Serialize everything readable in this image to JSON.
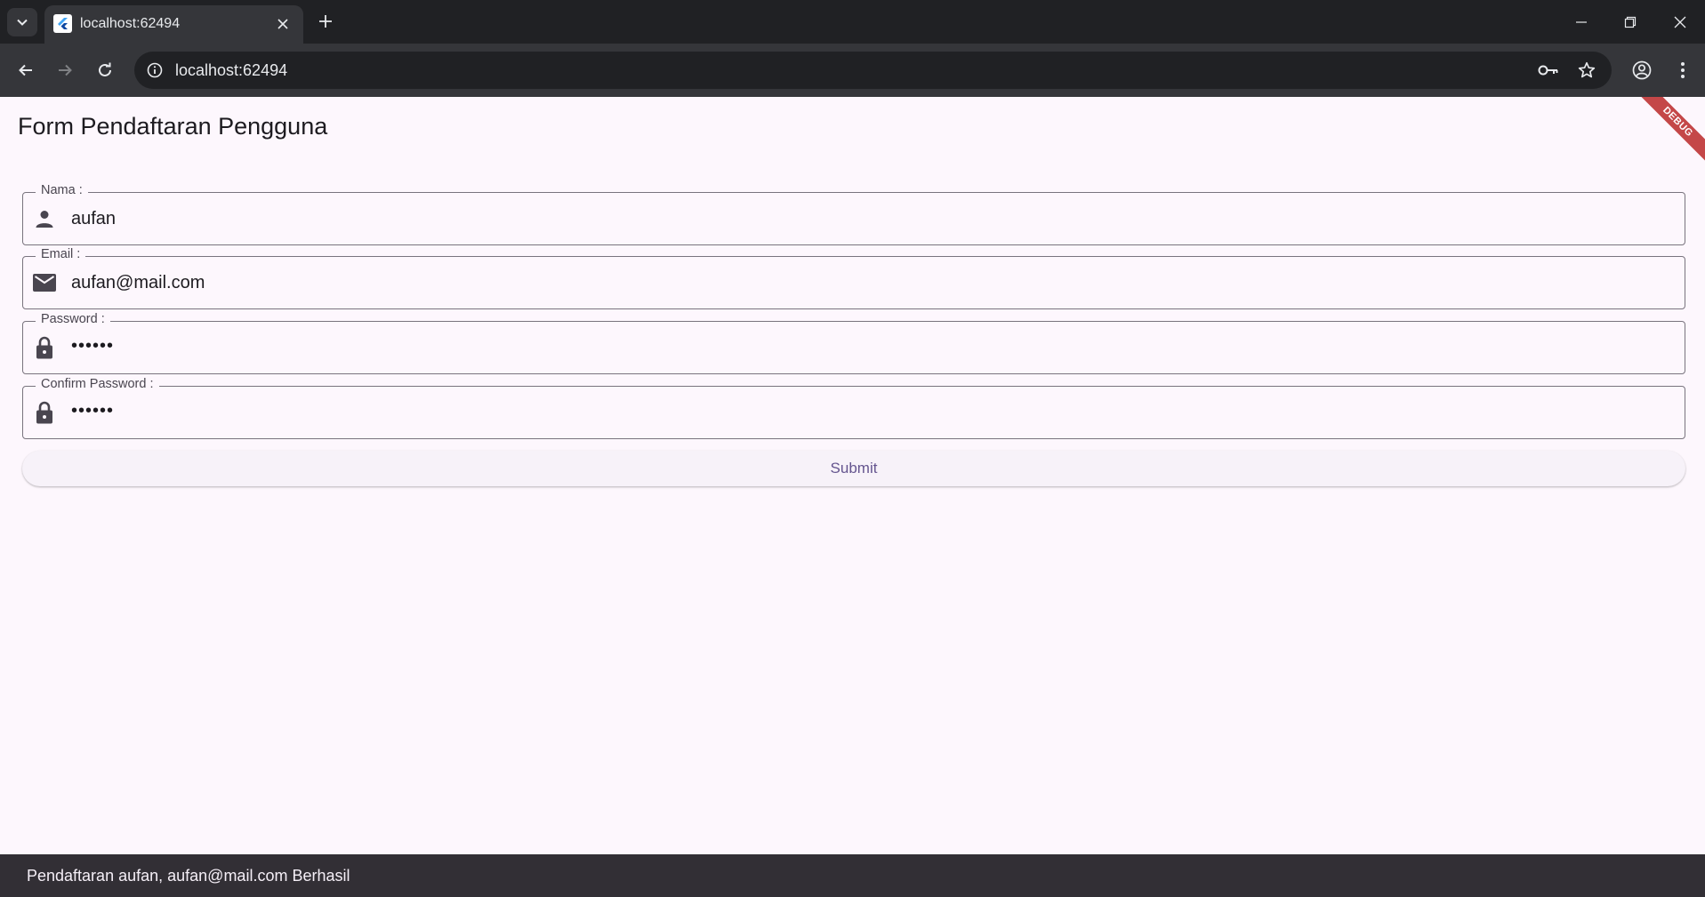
{
  "browser": {
    "tab_title": "localhost:62494",
    "url": "localhost:62494",
    "icons": [
      "tab-search-icon",
      "flutter-icon",
      "close-icon",
      "plus-icon",
      "minimize-icon",
      "restore-icon",
      "window-close-icon",
      "back-arrow-icon",
      "forward-arrow-icon",
      "reload-icon",
      "info-icon",
      "key-icon",
      "star-icon",
      "profile-icon",
      "kebab-menu-icon"
    ]
  },
  "app": {
    "debug_banner": "DEBUG",
    "title": "Form Pendaftaran Pengguna"
  },
  "form": {
    "fields": [
      {
        "label": "Nama :",
        "value": "aufan",
        "icon": "person-icon"
      },
      {
        "label": "Email :",
        "value": "aufan@mail.com",
        "icon": "mail-icon"
      },
      {
        "label": "Password :",
        "value": "••••••",
        "icon": "lock-icon"
      },
      {
        "label": "Confirm Password :",
        "value": "••••••",
        "icon": "lock-icon"
      }
    ],
    "submit_label": "Submit"
  },
  "snackbar": {
    "message": "Pendaftaran aufan, aufan@mail.com Berhasil"
  },
  "colors": {
    "background": "#fdf7fd",
    "primary": "#65558f",
    "outline": "#79747e",
    "snackbar": "#322f35",
    "debug": "#b71c1c"
  }
}
